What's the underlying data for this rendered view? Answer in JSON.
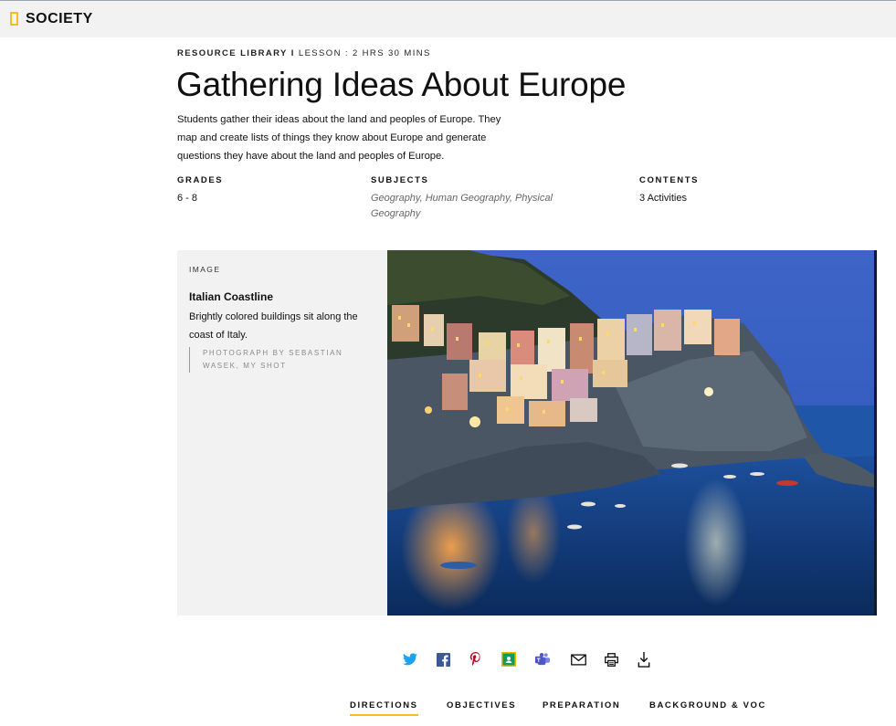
{
  "header": {
    "logo_text": "SOCIETY"
  },
  "breadcrumb": {
    "section": "RESOURCE LIBRARY",
    "separator": "I",
    "info": "LESSON : 2 HRS 30 MINS"
  },
  "page": {
    "title": "Gathering Ideas About Europe",
    "description": "Students gather their ideas about the land and peoples of Europe. They map and create lists of things they know about Europe and generate questions they have about the land and peoples of Europe."
  },
  "meta": {
    "grades_label": "GRADES",
    "grades_value": "6 - 8",
    "subjects_label": "SUBJECTS",
    "subjects_value": "Geography, Human Geography, Physical Geography",
    "contents_label": "CONTENTS",
    "contents_value": "3 Activities"
  },
  "media": {
    "type": "IMAGE",
    "title": "Italian Coastline",
    "caption": "Brightly colored buildings sit along the coast of Italy.",
    "credit": "PHOTOGRAPH BY SEBASTIAN WASEK, MY SHOT"
  },
  "share": {
    "icons": [
      "twitter-icon",
      "facebook-icon",
      "pinterest-icon",
      "google-classroom-icon",
      "microsoft-teams-icon",
      "email-icon",
      "print-icon",
      "download-icon"
    ],
    "colors": {
      "twitter": "#1da1f2",
      "facebook": "#3b5998",
      "pinterest": "#bd081c",
      "classroom": "#0f9d58",
      "teams": "#5059c9"
    }
  },
  "tabs": {
    "directions": "DIRECTIONS",
    "objectives": "OBJECTIVES",
    "preparation": "PREPARATION",
    "background": "BACKGROUND & VOCA"
  },
  "colors": {
    "accent": "#f2c01b",
    "panel_bg": "#f2f2f2"
  }
}
